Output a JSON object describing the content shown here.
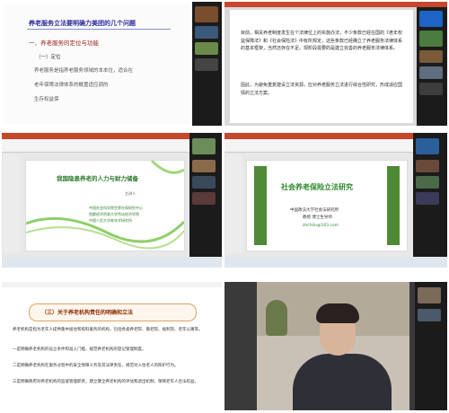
{
  "panel1": {
    "title": "养老服务立法要明确力美团的几个问题",
    "heading": "一、养老服务的定位与功能",
    "sub": "（一）定位",
    "lines": [
      "养老服务是指养老服务领域的本本位，适合在",
      "老年保障法律体系的概置适应调的",
      "生存权益保"
    ],
    "icons": [
      "slide-icon",
      "person-icon"
    ]
  },
  "panel2": {
    "para1": "目前，相关养老制度发生在个法律位上的实施办法，不少条款已经在国的《老年权益保障法》和《社会保险法》中有所规定，这些条款已经确立了养老服务法律体系的基本框架，当然还存在不足。现阶段需要的是建立完善的养老服务法律体系。",
    "para2": "因此，为避免重复建设立法资源，应对养老服务立法进行综合性研究，形成适应国情的立法方案。",
    "tag": "mute-icon"
  },
  "panel3": {
    "slide_title": "我国隐患养老的人力与财力储备",
    "author": "主讲人",
    "line1": "中国社会科学院世界社保研究中心",
    "line2": "首都经济贸易大学劳动经济学院",
    "line3": "中国人民大学老年学研究所"
  },
  "panel4": {
    "slide_title": "社会养老保险立法研究",
    "presenter_line1": "中国政法大学社会法研究所",
    "presenter_line2": "教授  博士生导师",
    "email": "zhchlin@163.com"
  },
  "panel5": {
    "header": "（三）关于养老机构责任的明确和立法",
    "paragraphs": [
      "养老机构是指为老年人提供集中居住和照料服务的机构，包括各类养老院、敬老院、福利院、老年公寓等。",
      "一是明确养老机构的设立条件和准入门槛，规范养老机构的登记管理制度。",
      "二是明确养老机构在服务过程中的安全保障义务及其法律责任，规范对入住老人的照护行为。",
      "三是明确政府对养老机构的监督管理职责，建立健全养老机构的评估和退出机制，保障老年人合法权益。"
    ]
  },
  "panel6": {
    "speaker_label": "speaker-video"
  },
  "colors": {
    "dark_panel": "#1e1e1e",
    "ppt_orange": "#c7472d",
    "green_title": "#2f8a2f",
    "sidebar": "#1b1b1b"
  }
}
